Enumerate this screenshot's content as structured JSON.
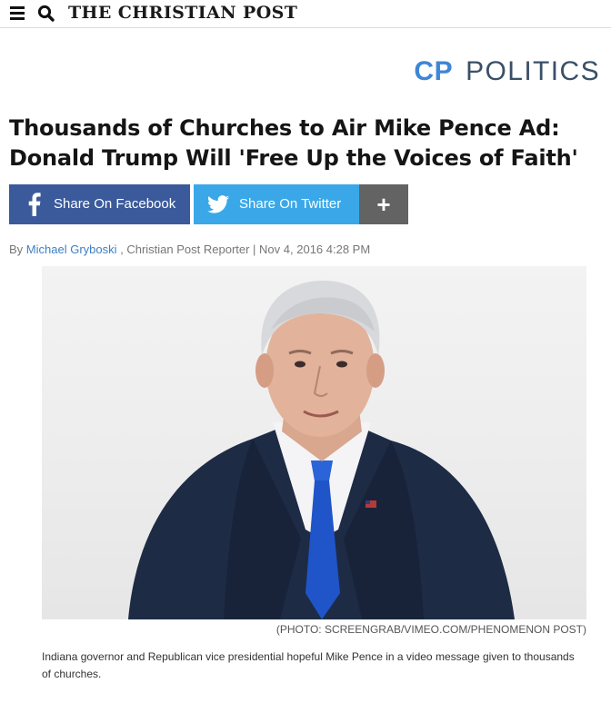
{
  "header": {
    "brand": "THE CHRISTIAN POST",
    "menu_icon": "hamburger-menu-icon",
    "search_icon": "search-icon"
  },
  "section": {
    "abbrev": "CP",
    "name": "POLITICS"
  },
  "article": {
    "headline_line1": "Thousands of Churches to Air Mike Pence Ad:",
    "headline_line2": "Donald Trump Will 'Free Up the Voices of Faith'",
    "byline": {
      "prefix": "By ",
      "author": "Michael Gryboski",
      "suffix": " , Christian Post Reporter | Nov 4, 2016 4:28 PM"
    },
    "photo_credit": "(PHOTO: SCREENGRAB/VIMEO.COM/PHENOMENON POST)",
    "caption": "Indiana governor and Republican vice presidential hopeful Mike Pence in a video message given to thousands of churches."
  },
  "share": {
    "facebook_label": "Share On Facebook",
    "twitter_label": "Share On Twitter",
    "more_label": "+"
  },
  "colors": {
    "facebook": "#3b5a9b",
    "twitter": "#3aa8e8",
    "more": "#636363",
    "accent": "#3e86d6",
    "link": "#3e7fc6"
  }
}
